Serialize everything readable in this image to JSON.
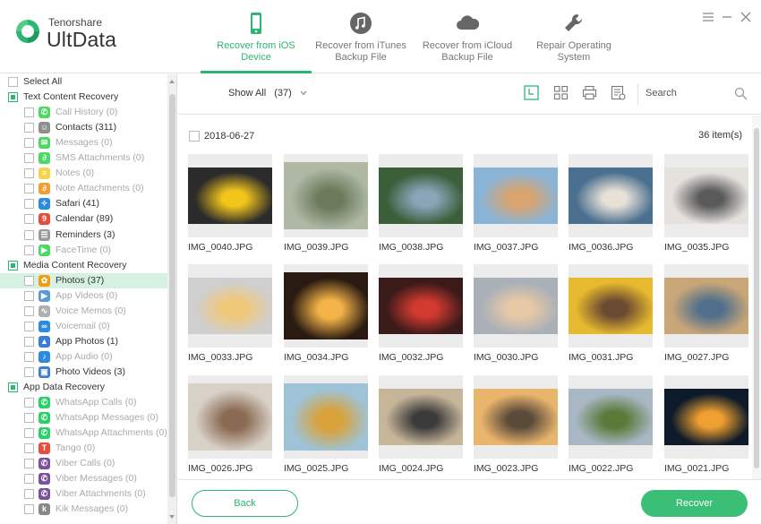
{
  "app": {
    "brand_small": "Tenorshare",
    "brand_name": "UltData",
    "accent": "#2bb673"
  },
  "nav_tabs": [
    {
      "label": "Recover from iOS\nDevice",
      "icon": "phone-icon",
      "active": true
    },
    {
      "label": "Recover from iTunes\nBackup File",
      "icon": "music-note-icon",
      "active": false
    },
    {
      "label": "Recover from iCloud\nBackup File",
      "icon": "cloud-icon",
      "active": false
    },
    {
      "label": "Repair Operating\nSystem",
      "icon": "wrench-icon",
      "active": false
    }
  ],
  "sidebar": {
    "select_all": "Select All",
    "categories": {
      "text": "Text Content Recovery",
      "media": "Media Content Recovery",
      "app": "App Data Recovery"
    },
    "items": [
      {
        "label": "Call History (0)",
        "icon": "phone-call-icon",
        "color": "#4cd964",
        "dim": true
      },
      {
        "label": "Contacts (311)",
        "icon": "contacts-icon",
        "color": "#8e8e8e",
        "dim": false
      },
      {
        "label": "Messages (0)",
        "icon": "messages-icon",
        "color": "#4cd964",
        "dim": true
      },
      {
        "label": "SMS Attachments (0)",
        "icon": "paperclip-icon",
        "color": "#4cd964",
        "dim": true
      },
      {
        "label": "Notes (0)",
        "icon": "notes-icon",
        "color": "#f5d547",
        "dim": true
      },
      {
        "label": "Note Attachments (0)",
        "icon": "paperclip-icon",
        "color": "#f0a030",
        "dim": true
      },
      {
        "label": "Safari (41)",
        "icon": "safari-icon",
        "color": "#2c8be0",
        "dim": false
      },
      {
        "label": "Calendar (89)",
        "icon": "calendar-icon",
        "color": "#e84c3d",
        "dim": false
      },
      {
        "label": "Reminders (3)",
        "icon": "reminders-icon",
        "color": "#9b9b9b",
        "dim": false
      },
      {
        "label": "FaceTime (0)",
        "icon": "facetime-icon",
        "color": "#4cd964",
        "dim": true
      },
      {
        "label": "Photos (37)",
        "icon": "photos-icon",
        "color": "#f39c12",
        "dim": false,
        "selected": true
      },
      {
        "label": "App Videos (0)",
        "icon": "video-icon",
        "color": "#5a9bd5",
        "dim": true
      },
      {
        "label": "Voice Memos (0)",
        "icon": "voice-memo-icon",
        "color": "#b0b0b0",
        "dim": true
      },
      {
        "label": "Voicemail (0)",
        "icon": "voicemail-icon",
        "color": "#2c8be0",
        "dim": true
      },
      {
        "label": "App Photos (1)",
        "icon": "app-photo-icon",
        "color": "#3b7dd8",
        "dim": false
      },
      {
        "label": "App Audio (0)",
        "icon": "audio-icon",
        "color": "#2c8be0",
        "dim": true
      },
      {
        "label": "Photo Videos (3)",
        "icon": "photo-video-icon",
        "color": "#3b7dd8",
        "dim": false
      },
      {
        "label": "WhatsApp Calls (0)",
        "icon": "whatsapp-icon",
        "color": "#25d366",
        "dim": true
      },
      {
        "label": "WhatsApp Messages (0)",
        "icon": "whatsapp-icon",
        "color": "#25d366",
        "dim": true
      },
      {
        "label": "WhatsApp Attachments (0)",
        "icon": "whatsapp-icon",
        "color": "#25d366",
        "dim": true
      },
      {
        "label": "Tango (0)",
        "icon": "tango-icon",
        "color": "#e84c3d",
        "dim": true
      },
      {
        "label": "Viber Calls (0)",
        "icon": "viber-icon",
        "color": "#7b519d",
        "dim": true
      },
      {
        "label": "Viber Messages (0)",
        "icon": "viber-icon",
        "color": "#7b519d",
        "dim": true
      },
      {
        "label": "Viber Attachments (0)",
        "icon": "viber-icon",
        "color": "#7b519d",
        "dim": true
      },
      {
        "label": "Kik Messages (0)",
        "icon": "kik-icon",
        "color": "#888888",
        "dim": true
      }
    ]
  },
  "toolbar": {
    "show_all": "Show All",
    "show_all_count": "(37)",
    "search_placeholder": "Search",
    "icons": [
      "grid-view-icon",
      "thumbnail-view-icon",
      "print-icon",
      "export-icon"
    ]
  },
  "content": {
    "date": "2018-06-27",
    "count": "36 item(s)",
    "photos": [
      {
        "name": "IMG_0040.JPG",
        "bg": "#2b2b2b",
        "fg": "#f2c51b",
        "tall": false
      },
      {
        "name": "IMG_0039.JPG",
        "bg": "#aeb8a5",
        "fg": "#6b7a5a",
        "tall": true
      },
      {
        "name": "IMG_0038.JPG",
        "bg": "#3a5f39",
        "fg": "#8aa4b8",
        "tall": false
      },
      {
        "name": "IMG_0037.JPG",
        "bg": "#89b4d6",
        "fg": "#d9a46f",
        "tall": false
      },
      {
        "name": "IMG_0036.JPG",
        "bg": "#4a6f8f",
        "fg": "#e6e0d6",
        "tall": false
      },
      {
        "name": "IMG_0035.JPG",
        "bg": "#e5e2de",
        "fg": "#5a5a5a",
        "tall": false
      },
      {
        "name": "IMG_0033.JPG",
        "bg": "#cfcfcf",
        "fg": "#f0c879",
        "tall": false
      },
      {
        "name": "IMG_0034.JPG",
        "bg": "#2a1b12",
        "fg": "#f4b348",
        "tall": true
      },
      {
        "name": "IMG_0032.JPG",
        "bg": "#3b1a1a",
        "fg": "#d23a2f",
        "tall": false
      },
      {
        "name": "IMG_0030.JPG",
        "bg": "#a9b0b8",
        "fg": "#e8c9a6",
        "tall": false
      },
      {
        "name": "IMG_0031.JPG",
        "bg": "#e6b92e",
        "fg": "#6b4a32",
        "tall": false
      },
      {
        "name": "IMG_0027.JPG",
        "bg": "#c8a678",
        "fg": "#4f6f8c",
        "tall": false
      },
      {
        "name": "IMG_0026.JPG",
        "bg": "#d8d1c8",
        "fg": "#8a6a52",
        "tall": true
      },
      {
        "name": "IMG_0025.JPG",
        "bg": "#9ec3d6",
        "fg": "#d9a23a",
        "tall": true
      },
      {
        "name": "IMG_0024.JPG",
        "bg": "#c7b59a",
        "fg": "#3b3b3b",
        "tall": false
      },
      {
        "name": "IMG_0023.JPG",
        "bg": "#e9b46c",
        "fg": "#5a4a3a",
        "tall": false
      },
      {
        "name": "IMG_0022.JPG",
        "bg": "#a9b7c4",
        "fg": "#5a7a3a",
        "tall": false
      },
      {
        "name": "IMG_0021.JPG",
        "bg": "#0d1a2a",
        "fg": "#f0a030",
        "tall": false
      }
    ]
  },
  "footer": {
    "back": "Back",
    "recover": "Recover"
  }
}
